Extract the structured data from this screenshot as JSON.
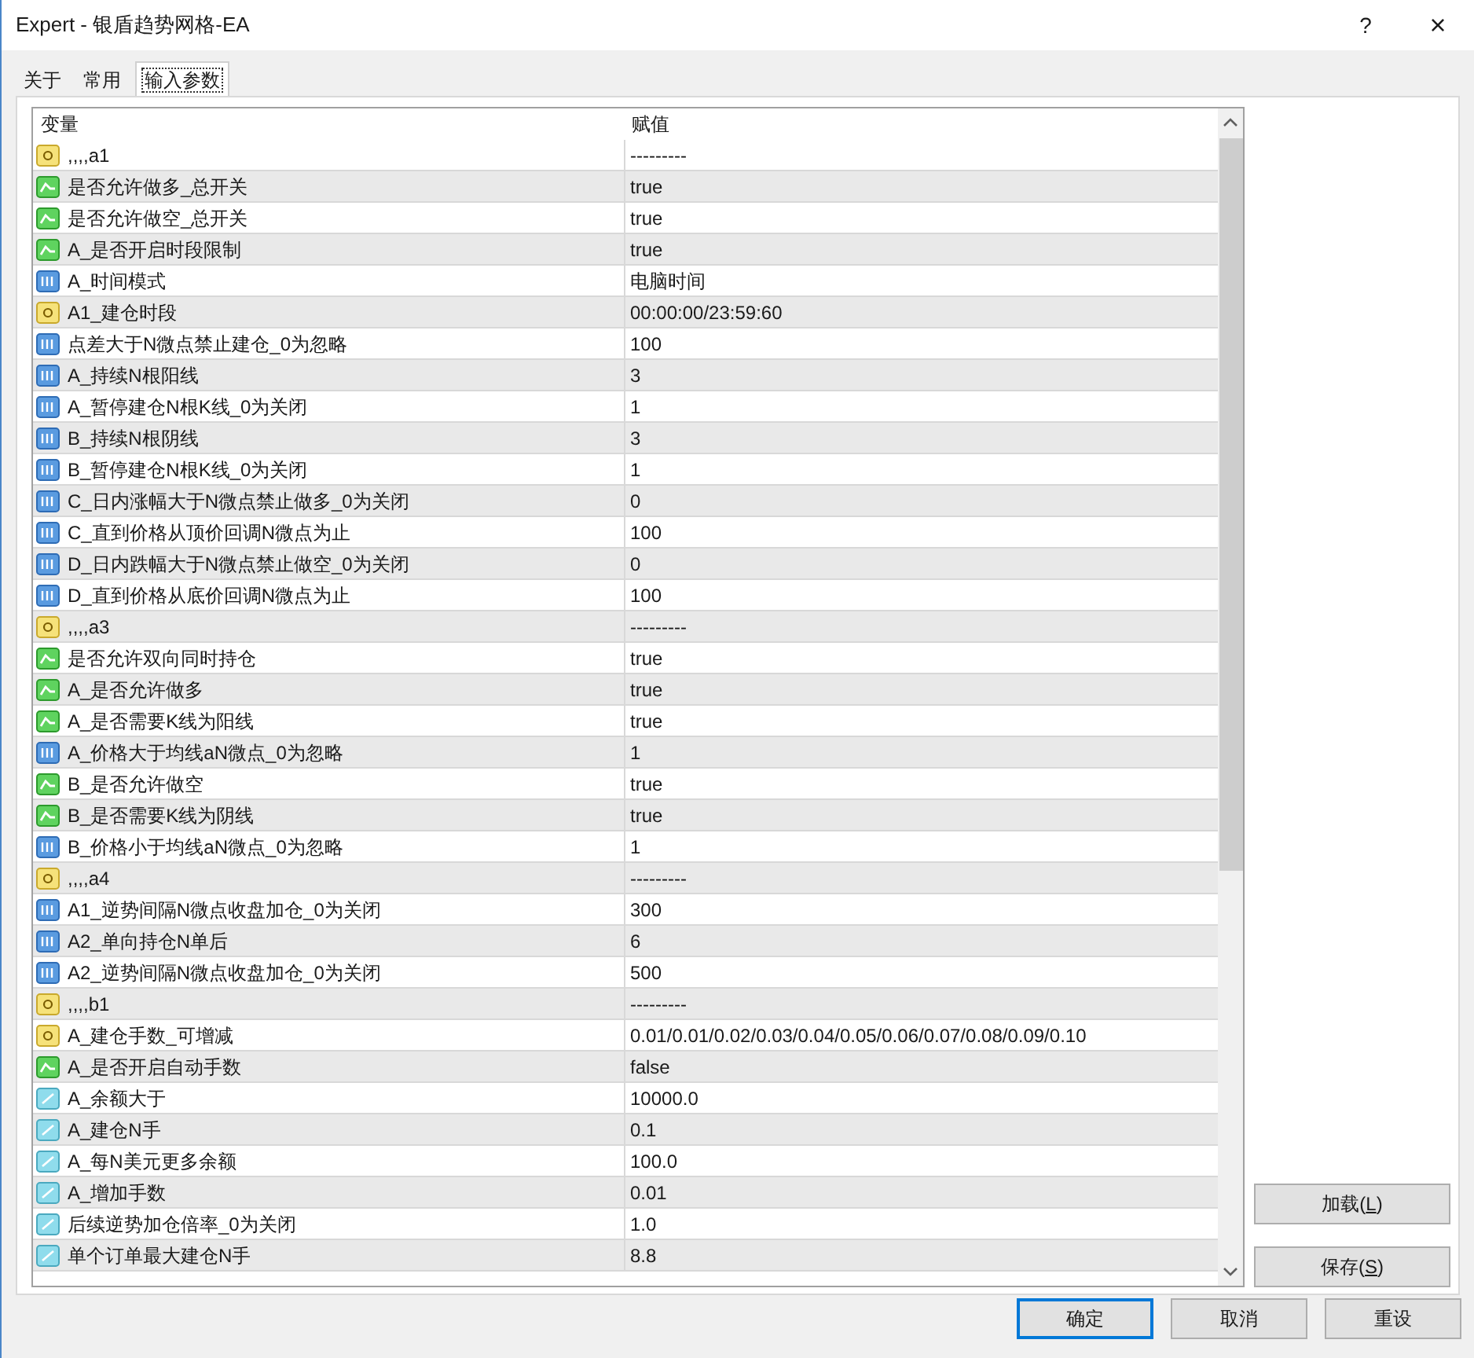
{
  "window": {
    "title": "Expert - 银盾趋势网格-EA",
    "help": "?",
    "close": "×"
  },
  "tabs": [
    {
      "label": "关于",
      "selected": false
    },
    {
      "label": "常用",
      "selected": false
    },
    {
      "label": "输入参数",
      "selected": true
    }
  ],
  "table": {
    "columns": [
      "变量",
      "赋值"
    ],
    "rows": [
      {
        "kind": "string",
        "name": ",,,,a1",
        "value": "---------"
      },
      {
        "kind": "bool",
        "name": "是否允许做多_总开关",
        "value": "true"
      },
      {
        "kind": "bool",
        "name": "是否允许做空_总开关",
        "value": "true"
      },
      {
        "kind": "bool",
        "name": "A_是否开启时段限制",
        "value": "true"
      },
      {
        "kind": "int",
        "name": "A_时间模式",
        "value": "电脑时间"
      },
      {
        "kind": "string",
        "name": "A1_建仓时段",
        "value": "00:00:00/23:59:60"
      },
      {
        "kind": "int",
        "name": "点差大于N微点禁止建仓_0为忽略",
        "value": "100"
      },
      {
        "kind": "int",
        "name": "A_持续N根阳线",
        "value": "3"
      },
      {
        "kind": "int",
        "name": "A_暂停建仓N根K线_0为关闭",
        "value": "1"
      },
      {
        "kind": "int",
        "name": "B_持续N根阴线",
        "value": "3"
      },
      {
        "kind": "int",
        "name": "B_暂停建仓N根K线_0为关闭",
        "value": "1"
      },
      {
        "kind": "int",
        "name": "C_日内涨幅大于N微点禁止做多_0为关闭",
        "value": "0"
      },
      {
        "kind": "int",
        "name": "C_直到价格从顶价回调N微点为止",
        "value": "100"
      },
      {
        "kind": "int",
        "name": "D_日内跌幅大于N微点禁止做空_0为关闭",
        "value": "0"
      },
      {
        "kind": "int",
        "name": "D_直到价格从底价回调N微点为止",
        "value": "100"
      },
      {
        "kind": "string",
        "name": ",,,,a3",
        "value": "---------"
      },
      {
        "kind": "bool",
        "name": "是否允许双向同时持仓",
        "value": "true"
      },
      {
        "kind": "bool",
        "name": "A_是否允许做多",
        "value": "true"
      },
      {
        "kind": "bool",
        "name": "A_是否需要K线为阳线",
        "value": "true"
      },
      {
        "kind": "int",
        "name": "A_价格大于均线aN微点_0为忽略",
        "value": "1"
      },
      {
        "kind": "bool",
        "name": "B_是否允许做空",
        "value": "true"
      },
      {
        "kind": "bool",
        "name": "B_是否需要K线为阴线",
        "value": "true"
      },
      {
        "kind": "int",
        "name": "B_价格小于均线aN微点_0为忽略",
        "value": "1"
      },
      {
        "kind": "string",
        "name": ",,,,a4",
        "value": "---------"
      },
      {
        "kind": "int",
        "name": "A1_逆势间隔N微点收盘加仓_0为关闭",
        "value": "300"
      },
      {
        "kind": "int",
        "name": "A2_单向持仓N单后",
        "value": "6"
      },
      {
        "kind": "int",
        "name": "A2_逆势间隔N微点收盘加仓_0为关闭",
        "value": "500"
      },
      {
        "kind": "string",
        "name": ",,,,b1",
        "value": "---------"
      },
      {
        "kind": "string",
        "name": "A_建仓手数_可增减",
        "value": "0.01/0.01/0.02/0.03/0.04/0.05/0.06/0.07/0.08/0.09/0.10"
      },
      {
        "kind": "bool",
        "name": "A_是否开启自动手数",
        "value": "false"
      },
      {
        "kind": "double",
        "name": "A_余额大于",
        "value": "10000.0"
      },
      {
        "kind": "double",
        "name": "A_建仓N手",
        "value": "0.1"
      },
      {
        "kind": "double",
        "name": "A_每N美元更多余额",
        "value": "100.0"
      },
      {
        "kind": "double",
        "name": "A_增加手数",
        "value": "0.01"
      },
      {
        "kind": "double",
        "name": "后续逆势加仓倍率_0为关闭",
        "value": "1.0"
      },
      {
        "kind": "double",
        "name": "单个订单最大建仓N手",
        "value": "8.8"
      }
    ]
  },
  "side_buttons": [
    {
      "before": "加载(",
      "accelerator": "L",
      "after": ")"
    },
    {
      "before": "保存(",
      "accelerator": "S",
      "after": ")"
    }
  ],
  "buttons": [
    {
      "label": "确定",
      "default": true
    },
    {
      "label": "取消",
      "default": false
    },
    {
      "label": "重设",
      "default": false
    }
  ]
}
